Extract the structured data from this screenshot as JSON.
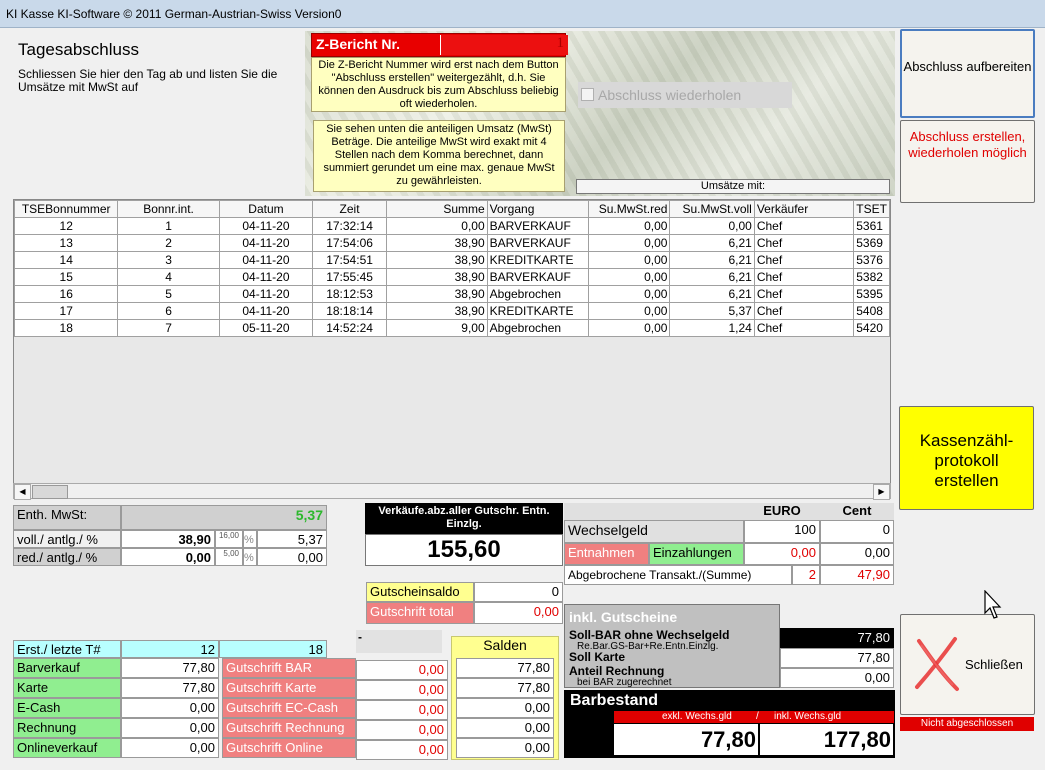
{
  "window": {
    "title": "KI Kasse  KI-Software ©  2011 German-Austrian-Swiss Version0"
  },
  "header": {
    "title": "Tagesabschluss",
    "subtitle": "Schliessen Sie hier den Tag ab und listen Sie die Umsätze mit MwSt auf"
  },
  "zbericht": {
    "label": "Z-Bericht Nr.",
    "number": "1",
    "note1": "Die Z-Bericht Nummer wird erst nach dem Button \"Abschluss erstellen\" weitergezählt, d.h. Sie können den Ausdruck bis zum Abschluss beliebig oft wiederholen.",
    "note2": "Sie sehen unten die anteiligen Umsatz (MwSt) Beträge. Die anteilige MwSt wird exakt mit 4 Stellen nach dem Komma berechnet, dann summiert gerundet um eine max. genaue MwSt zu gewährleisten."
  },
  "repeat_checkbox": {
    "label": "Abschluss wiederholen"
  },
  "umsaetze_label": "Umsätze mit:",
  "buttons": {
    "prepare": "Abschluss aufbereiten",
    "create": "Abschluss erstellen, wiederholen möglich",
    "kassen": "Kassenzähl-protokoll erstellen",
    "close": "Schließen",
    "close_status": "Nicht abgeschlossen"
  },
  "table": {
    "columns": [
      "TSEBonnummer",
      "Bonnr.int.",
      "Datum",
      "Zeit",
      "Summe",
      "Vorgang",
      "Su.MwSt.red",
      "Su.MwSt.voll",
      "Verkäufer",
      "TSET"
    ],
    "rows": [
      [
        "12",
        "1",
        "04-11-20",
        "17:32:14",
        "0,00",
        "BARVERKAUF",
        "0,00",
        "0,00",
        "Chef",
        "5361"
      ],
      [
        "13",
        "2",
        "04-11-20",
        "17:54:06",
        "38,90",
        "BARVERKAUF",
        "0,00",
        "6,21",
        "Chef",
        "5369"
      ],
      [
        "14",
        "3",
        "04-11-20",
        "17:54:51",
        "38,90",
        "KREDITKARTE",
        "0,00",
        "6,21",
        "Chef",
        "5376"
      ],
      [
        "15",
        "4",
        "04-11-20",
        "17:55:45",
        "38,90",
        "BARVERKAUF",
        "0,00",
        "6,21",
        "Chef",
        "5382"
      ],
      [
        "16",
        "5",
        "04-11-20",
        "18:12:53",
        "38,90",
        "Abgebrochen",
        "0,00",
        "6,21",
        "Chef",
        "5395"
      ],
      [
        "17",
        "6",
        "04-11-20",
        "18:18:14",
        "38,90",
        "KREDITKARTE",
        "0,00",
        "5,37",
        "Chef",
        "5408"
      ],
      [
        "18",
        "7",
        "05-11-20",
        "14:52:24",
        "9,00",
        "Abgebrochen",
        "0,00",
        "1,24",
        "Chef",
        "5420"
      ]
    ]
  },
  "mwst": {
    "label": "Enth. MwSt:",
    "total": "5,37",
    "voll_label": "voll./ antlg./ %",
    "voll_amount": "38,90",
    "voll_rate": "16,00",
    "voll_pct": "%",
    "voll_tax": "5,37",
    "red_label": "red./ antlg./ %",
    "red_amount": "0,00",
    "red_rate": "5,00",
    "red_pct": "%",
    "red_tax": "0,00"
  },
  "verkaeufe": {
    "label": "Verkäufe.abz.aller Gutschr. Entn. Einzlg.",
    "value": "155,60"
  },
  "gutschein": {
    "saldo_label": "Gutscheinsaldo",
    "saldo": "0",
    "total_label": "Gutschrift total",
    "total": "0,00"
  },
  "wechsel": {
    "col_euro": "EURO",
    "col_cent": "Cent",
    "label": "Wechselgeld",
    "euro": "100",
    "cent": "0",
    "entnahmen_label": "Entnahmen",
    "einzahlungen_label": "Einzahlungen",
    "entnahmen": "0,00",
    "einzahlungen": "0,00",
    "abgebr_label": "Abgebrochene Transakt./(Summe)",
    "abgebr_count": "2",
    "abgebr_sum": "47,90"
  },
  "inkl": {
    "title": "inkl. Gutscheine",
    "soll_bar": "Soll-BAR ohne Wechselgeld",
    "soll_bar_sub": "Re.Bar.GS-Bar+Re.Entn.Einzlg.",
    "soll_karte": "Soll Karte",
    "anteil": "Anteil Rechnung",
    "anteil_sub": "bei BAR zugerechnet",
    "v1": "77,80",
    "v2": "77,80",
    "v3": "0,00"
  },
  "barbestand": {
    "title": "Barbestand",
    "exkl_label": "exkl. Wechs.gld",
    "sep": "/",
    "inkl_label": "inkl. Wechs.gld",
    "exkl": "77,80",
    "inkl": "177,80"
  },
  "summary": {
    "erst_label": "Erst./ letzte T#",
    "erst": "12",
    "letzte": "18",
    "dash": "-",
    "rows": [
      {
        "label": "Barverkauf",
        "value": "77,80",
        "g_label": "Gutschrift BAR",
        "g_value": "0,00",
        "saldo": "77,80"
      },
      {
        "label": "Karte",
        "value": "77,80",
        "g_label": "Gutschrift Karte",
        "g_value": "0,00",
        "saldo": "77,80"
      },
      {
        "label": "E-Cash",
        "value": "0,00",
        "g_label": "Gutschrift EC-Cash",
        "g_value": "0,00",
        "saldo": "0,00"
      },
      {
        "label": "Rechnung",
        "value": "0,00",
        "g_label": "Gutschrift Rechnung",
        "g_value": "0,00",
        "saldo": "0,00"
      },
      {
        "label": "Onlineverkauf",
        "value": "0,00",
        "g_label": "Gutschrift Online",
        "g_value": "0,00",
        "saldo": "0,00"
      }
    ],
    "salden_label": "Salden"
  }
}
